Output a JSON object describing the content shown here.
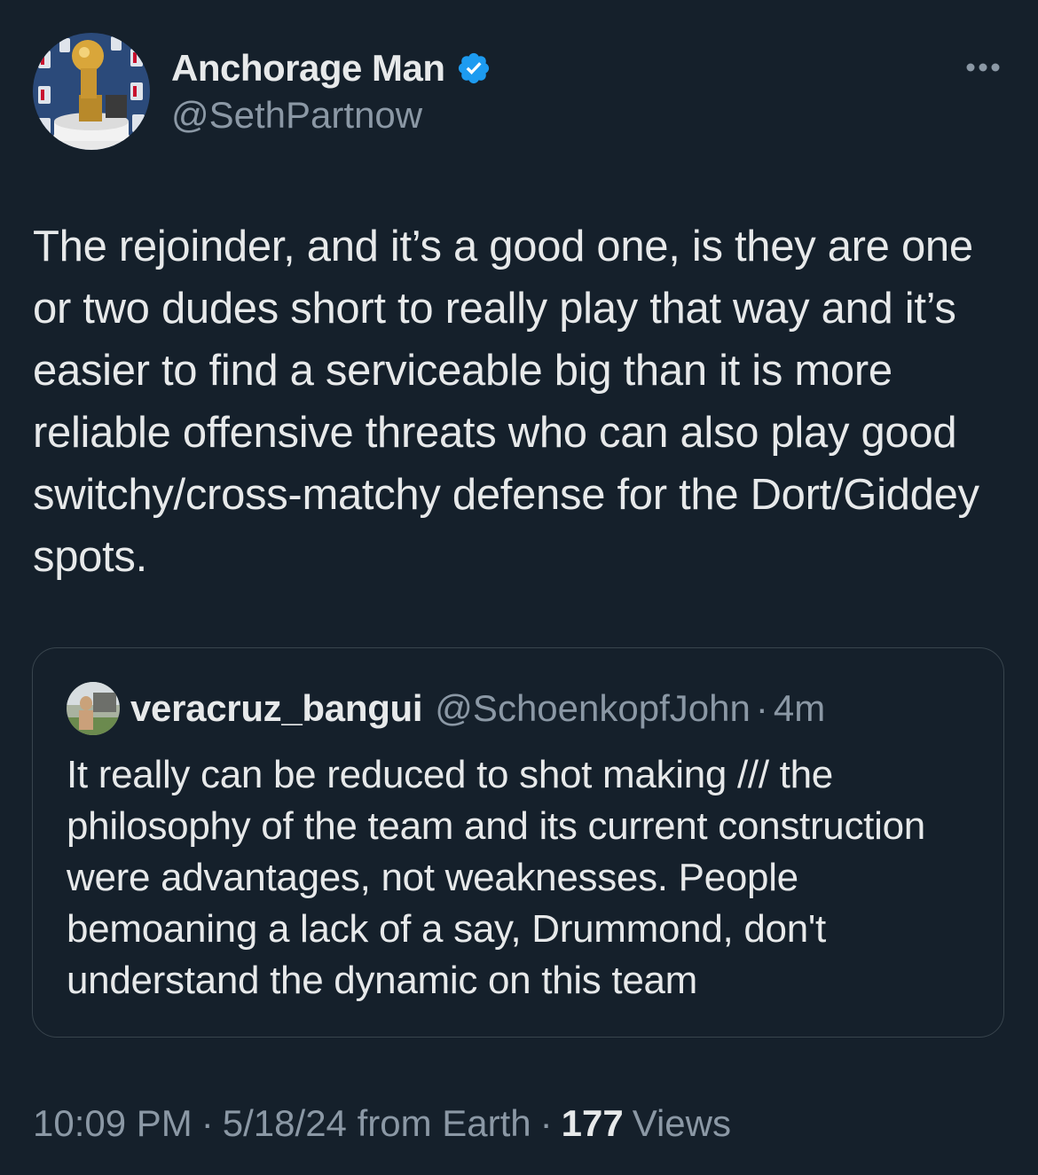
{
  "author": {
    "display_name": "Anchorage Man",
    "handle": "@SethPartnow",
    "verified_icon": "verified-badge-icon",
    "avatar_icon": "avatar-trophy-image"
  },
  "more_icon": "more-options-icon",
  "tweet": {
    "text": "The rejoinder, and it’s a good one, is they are one or two dudes short to really play that way and it’s easier to find a serviceable big than it is more reliable offensive threats who can also play good switchy/cross-matchy defense for the Dort/Giddey spots."
  },
  "quoted_tweet": {
    "display_name": "veracruz_bangui",
    "handle": "@SchoenkopfJohn",
    "separator": "·",
    "time": "4m",
    "text": "It really can be reduced to shot making /// the philosophy of the team and its current construction were advantages, not weaknesses. People bemoaning a lack of a say, Drummond, don't understand the dynamic on this team"
  },
  "meta": {
    "time": "10:09 PM",
    "sep1": "·",
    "date_source": "5/18/24 from Earth",
    "sep2": "·",
    "views_count": "177",
    "views_label": "Views"
  },
  "colors": {
    "background": "#15202b",
    "text": "#e7e9ea",
    "secondary": "#8b98a5",
    "verified_blue": "#1d9bf0",
    "border": "#38444d"
  }
}
